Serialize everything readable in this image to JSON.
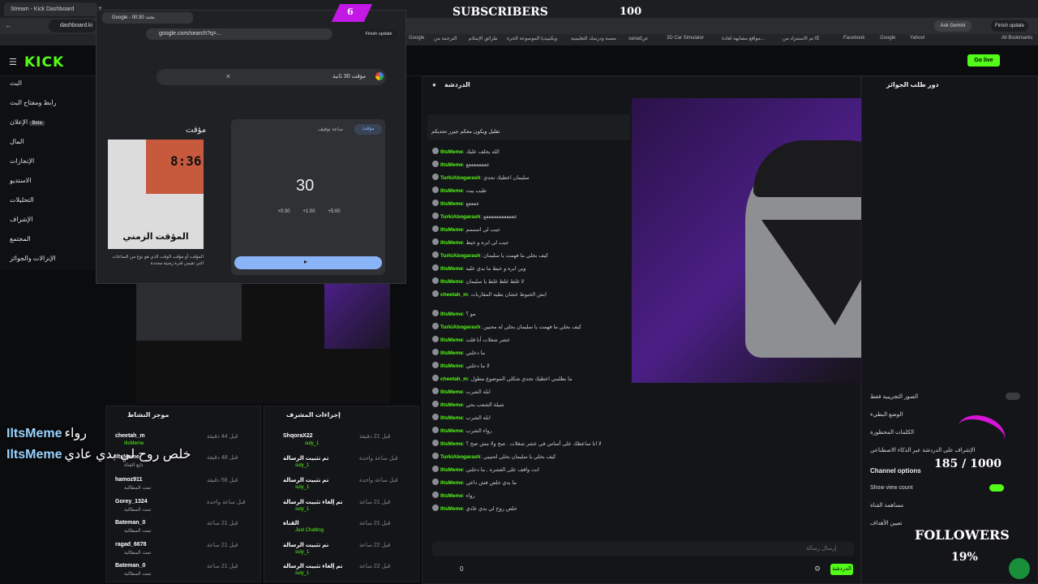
{
  "browser": {
    "main_tab": "Stream - Kick Dashboard",
    "main_url": "dashboard.ki",
    "google_tab": "Google - بحث 00:30",
    "google_url": "google.com/search?q=...",
    "ask_gemini": "Ask Gemini",
    "finish_update": "Finish update",
    "bookmarks": [
      "3D Car Simulator - ...",
      "مواقع مشابهة لغادة...",
      "تم الاستنزاد من IE",
      "Facebook",
      "Google",
      "الترجمة من",
      "طرائق الإسلام",
      "ويكيبيديا الموسوعة الحرة",
      "منصة ودرسك التعليمية",
      "sanadعن",
      "3D Car Simulator",
      "مواقع مشابهة لغادة...",
      "تم الاستنزاد من IE",
      "Facebook",
      "Google",
      "Yahoo!"
    ],
    "all_bookmarks": "All Bookmarks"
  },
  "overlay": {
    "subscribers_label": "SUBSCRIBERS",
    "subscribers_count": "100",
    "badge": "6",
    "subs_progress": "185 / 1000",
    "followers_label": "FOLLOWERS",
    "followers_percent": "19%",
    "chat_name_1": "IltsMeme",
    "chat_msg_1": "رواء",
    "chat_name_2": "IltsMeme",
    "chat_msg_2": "خلص روح لي بدي عادي"
  },
  "kick": {
    "logo": "KICK",
    "go_live": "Go live",
    "sidebar": [
      "البث",
      "رابط ومفتاح البث",
      "الإعلان",
      "المال",
      "الإنجازات",
      "الاستديو",
      "التحليلات",
      "الإشراف",
      "المجتمع",
      "الإنزالات والجوائز"
    ],
    "beta": "Beta",
    "chat_title": "الدردشة",
    "rewards_title": "دور طلب الجوائز",
    "activity_title": "موجز النشاط",
    "mod_title": "إجراءات المشرف",
    "send_button": "الدردشة",
    "send_placeholder": "إرسال رسالة",
    "viewer_count": "0"
  },
  "google": {
    "search_text": "مؤقت 30 ثانية",
    "timer_label": "مؤقت",
    "stopwatch_label": "ساعة توقيف",
    "timer_value": "30",
    "quick_add": [
      "+0:30",
      "+1:00",
      "+5:00"
    ],
    "side_title": "مؤقت",
    "thumb_time": "8:36",
    "thumb_caption": "المؤقت الزمني",
    "desc": "المؤقت أو مؤقت الوقت الذي هو نوع من الساعات التي تقيس فترة زمنية محددة"
  },
  "chat": [
    {
      "user": "",
      "msg": "تقليل ويكون معكم جيزر تحديكم"
    },
    {
      "user": "IltsMeme",
      "msg": "الله يخلف عليك"
    },
    {
      "user": "IltsMeme",
      "msg": "ععععععععع"
    },
    {
      "user": "TurkiAbogarash",
      "msg": "سليمان اعطيك تحدي"
    },
    {
      "user": "IltsMeme",
      "msg": "طيب يبت"
    },
    {
      "user": "IltsMeme",
      "msg": "ععععع"
    },
    {
      "user": "TurkiAbogarash",
      "msg": "ععععععععععععع"
    },
    {
      "user": "IltsMeme",
      "msg": "جيب لي اسممم"
    },
    {
      "user": "IltsMeme",
      "msg": "جيب لي ابره و خيط"
    },
    {
      "user": "TurkiAbogarash",
      "msg": "كيف بخلي ما فهمت يا سليمان"
    },
    {
      "user": "IltsMeme",
      "msg": "وين ابره و خيط ما بدي عليه"
    },
    {
      "user": "IltsMeme",
      "msg": "لا غلط غلط غلط يا سليمان"
    },
    {
      "user": "cheetah_m",
      "msg": "ابش الخيوط عشان بطيه المقاربات"
    },
    {
      "user": "IltsMeme",
      "msg": "مو ؟"
    },
    {
      "user": "TurkiAbogarash",
      "msg": "كيف بخلي ما فهمت يا سليمان بخلي له محبين"
    },
    {
      "user": "IltsMeme",
      "msg": "عشر شغلات أنا قلت"
    },
    {
      "user": "IltsMeme",
      "msg": "ما دخلني"
    },
    {
      "user": "IltsMeme",
      "msg": "لا ما دخلني"
    },
    {
      "user": "cheetah_m",
      "msg": "ما بطلبني اعطيك تحدي شكلي الموضوع مطول"
    },
    {
      "user": "IltsMeme",
      "msg": "ابله الشرب"
    },
    {
      "user": "IltsMeme",
      "msg": "شيلة الشعب بحي"
    },
    {
      "user": "IltsMeme",
      "msg": "ابله الشرب"
    },
    {
      "user": "IltsMeme",
      "msg": "رواء الشرب"
    },
    {
      "user": "IltsMeme",
      "msg": "لا انا ساعطك على أساس في عشر شغلات . صح ولا مش صح ؟"
    },
    {
      "user": "TurkiAbogarash",
      "msg": "كيف بخلي يا سليمان بخلي لحبيبي"
    },
    {
      "user": "IltsMeme",
      "msg": "انت واقف على العشره , ما دخلني"
    },
    {
      "user": "IltsMeme",
      "msg": "ما بدي خلص فش داعي"
    },
    {
      "user": "IltsMeme",
      "msg": "رواء"
    },
    {
      "user": "IltsMeme",
      "msg": "خلص روح لي بدي عادي"
    }
  ],
  "activity": [
    {
      "user": "cheetah_m",
      "sub": "IltsMeme",
      "time": "قبل 44 دقيقة"
    },
    {
      "user": "IltsMeme",
      "sub": "تابع القناة",
      "time": "قبل 48 دقيقة"
    },
    {
      "user": "hamoz911",
      "sub": "تمت المطالبة",
      "time": "قبل 56 دقيقة"
    },
    {
      "user": "Gorey_1324",
      "sub": "تمت المطالبة",
      "time": "قبل ساعة واحدة"
    },
    {
      "user": "Bateman_0",
      "sub": "تمت المطالبة",
      "time": "قبل 21 ساعة"
    },
    {
      "user": "ragad_6678",
      "sub": "تمت المطالبة",
      "time": "قبل 21 ساعة"
    },
    {
      "user": "Bateman_0",
      "sub": "تمت المطالبة",
      "time": "قبل 21 ساعة"
    }
  ],
  "mod_actions": [
    {
      "title": "ShqoraX22",
      "sub": "suly_1",
      "time": "قبل 21 دقيقة"
    },
    {
      "title": "تم تثبيت الرسالة",
      "sub": "suly_1",
      "time": "قبل ساعة واحدة"
    },
    {
      "title": "تم تثبيت الرسالة",
      "sub": "suly_1",
      "time": "قبل ساعة واحدة"
    },
    {
      "title": "تم إلغاء تثبيت الرسالة",
      "sub": "suly_1",
      "time": "قبل 21 ساعة"
    },
    {
      "title": "القناة",
      "sub": "Just Chatting",
      "time": "قبل 21 ساعة"
    },
    {
      "title": "تم تثبيت الرسالة",
      "sub": "suly_1",
      "time": "قبل 22 ساعة"
    },
    {
      "title": "تم إلغاء تثبيت الرسالة",
      "sub": "suly_1",
      "time": "قبل 22 ساعة"
    }
  ],
  "settings": {
    "label_1": "الصور التجريبية فقط",
    "label_2": "الوضع البطيء",
    "label_3": "الكلمات المحظورة",
    "label_4": "الإشراف على الدردشة عبر الذكاء الاصطناعي",
    "channel_options": "Channel options",
    "show_view_count": "Show view count",
    "label_5": "مساهمة القناة",
    "label_6": "تعيين الأهداف"
  }
}
